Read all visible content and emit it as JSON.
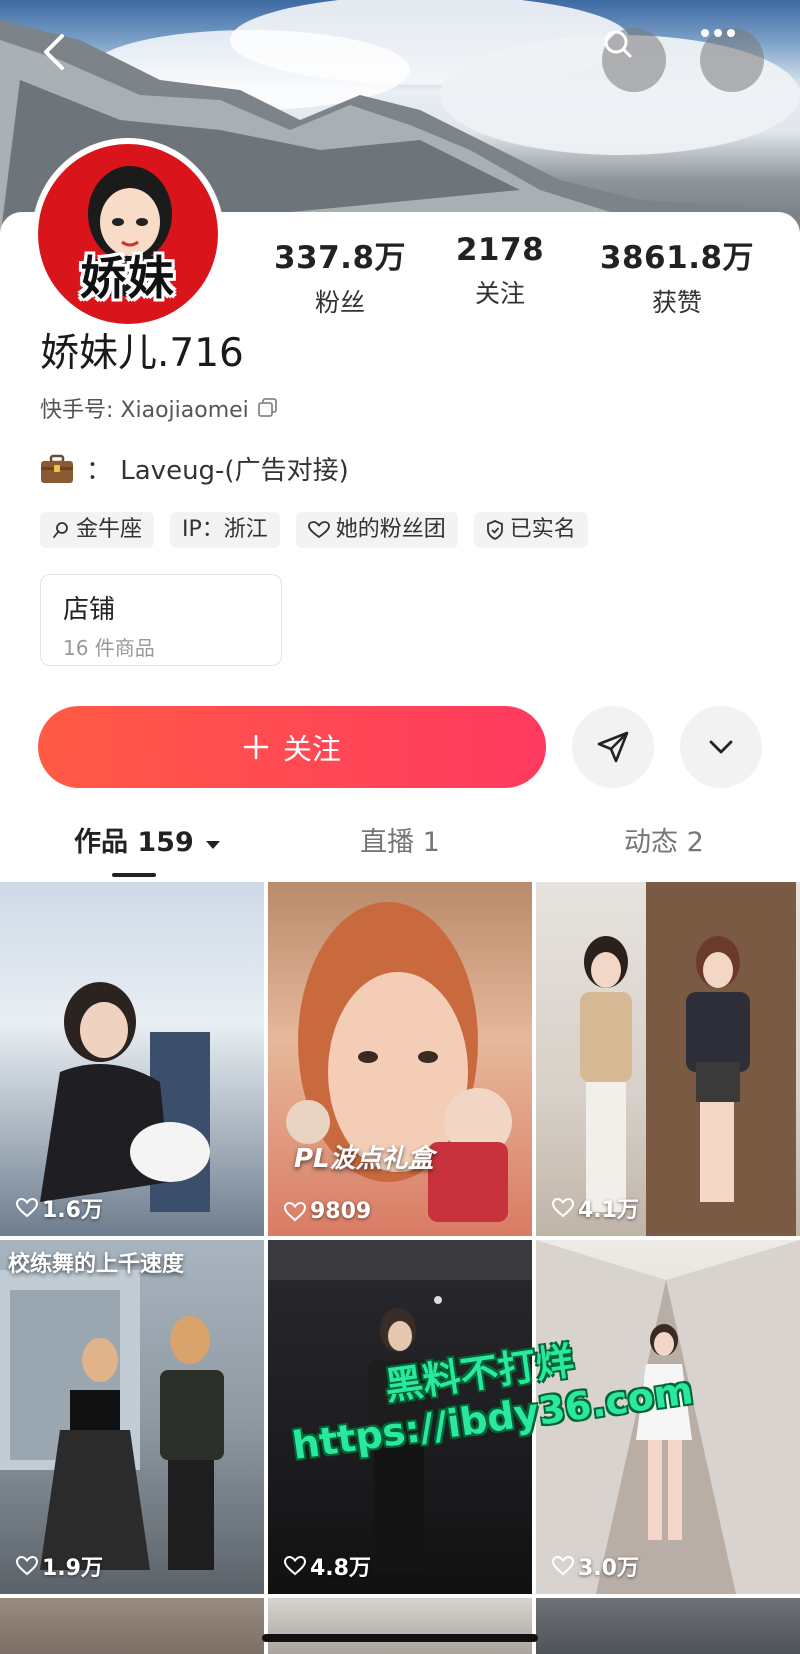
{
  "profile": {
    "avatar_text": "娇妹",
    "username": "娇妹儿.716",
    "ks_id_label": "快手号: Xiaojiaomei",
    "business_text": "：  Laveug-(广告对接)",
    "stats": [
      {
        "value": "337.8万",
        "label": "粉丝"
      },
      {
        "value": "2178",
        "label": "关注"
      },
      {
        "value": "3861.8万",
        "label": "获赞"
      }
    ],
    "tags": [
      {
        "label": "金牛座",
        "icon": "zodiac-icon"
      },
      {
        "label": "IP：浙江",
        "icon": ""
      },
      {
        "label": "她的粉丝团",
        "icon": "heart-outline-icon"
      },
      {
        "label": "已实名",
        "icon": "shield-icon"
      }
    ]
  },
  "shop": {
    "title": "店铺",
    "subtitle": "16 件商品"
  },
  "actions": {
    "follow_label": "关注",
    "follow_icon": "plus-icon",
    "share_icon": "send-icon",
    "more_icon": "chevron-down-icon"
  },
  "tabs": [
    {
      "label": "作品 159",
      "active": true
    },
    {
      "label": "直播 1",
      "active": false
    },
    {
      "label": "动态 2",
      "active": false
    }
  ],
  "videos": [
    {
      "likes": "1.6万",
      "overlay": ""
    },
    {
      "likes": "9809",
      "overlay": "PL波点礼盒"
    },
    {
      "likes": "4.1万",
      "overlay": ""
    },
    {
      "likes": "1.9万",
      "overlay": "校练舞的上千速度"
    },
    {
      "likes": "4.8万",
      "overlay": ""
    },
    {
      "likes": "3.0万",
      "overlay": ""
    }
  ],
  "watermark": {
    "line1": "黑料不打烊",
    "line2": "https://ibdy36.com"
  },
  "colors": {
    "accent_start": "#ff5a45",
    "accent_end": "#ff3a60",
    "avatar_bg": "#d9141a"
  }
}
